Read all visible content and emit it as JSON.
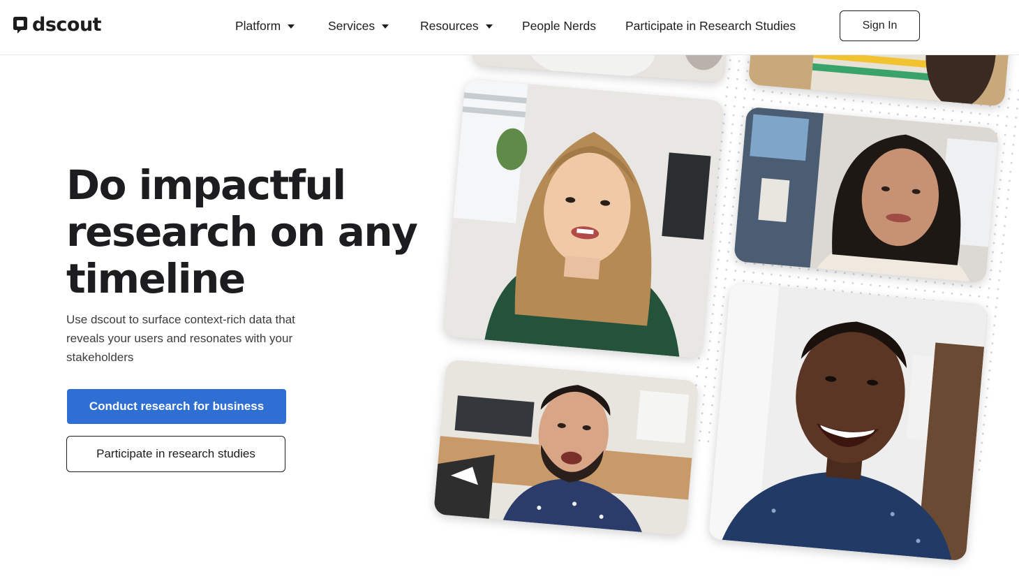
{
  "brand": {
    "name": "dscout",
    "logo_icon": "speech-bubble-icon"
  },
  "nav": {
    "items": [
      {
        "label": "Platform",
        "has_dropdown": true
      },
      {
        "label": "Services",
        "has_dropdown": true
      },
      {
        "label": "Resources",
        "has_dropdown": true
      },
      {
        "label": "People Nerds",
        "has_dropdown": false
      },
      {
        "label": "Participate in Research Studies",
        "has_dropdown": false
      }
    ],
    "sign_in_label": "Sign In"
  },
  "hero": {
    "headline_lines": [
      "Do impactful",
      "research on any",
      "timeline"
    ],
    "subtitle": "Use dscout to surface context-rich data that reveals your users and resonates with your stakeholders",
    "primary_cta": "Conduct research for business",
    "secondary_cta": "Participate in research studies"
  },
  "colors": {
    "primary_button": "#2f6fd4",
    "text": "#1d1d1f",
    "dot_pattern": "#cfd3da"
  }
}
